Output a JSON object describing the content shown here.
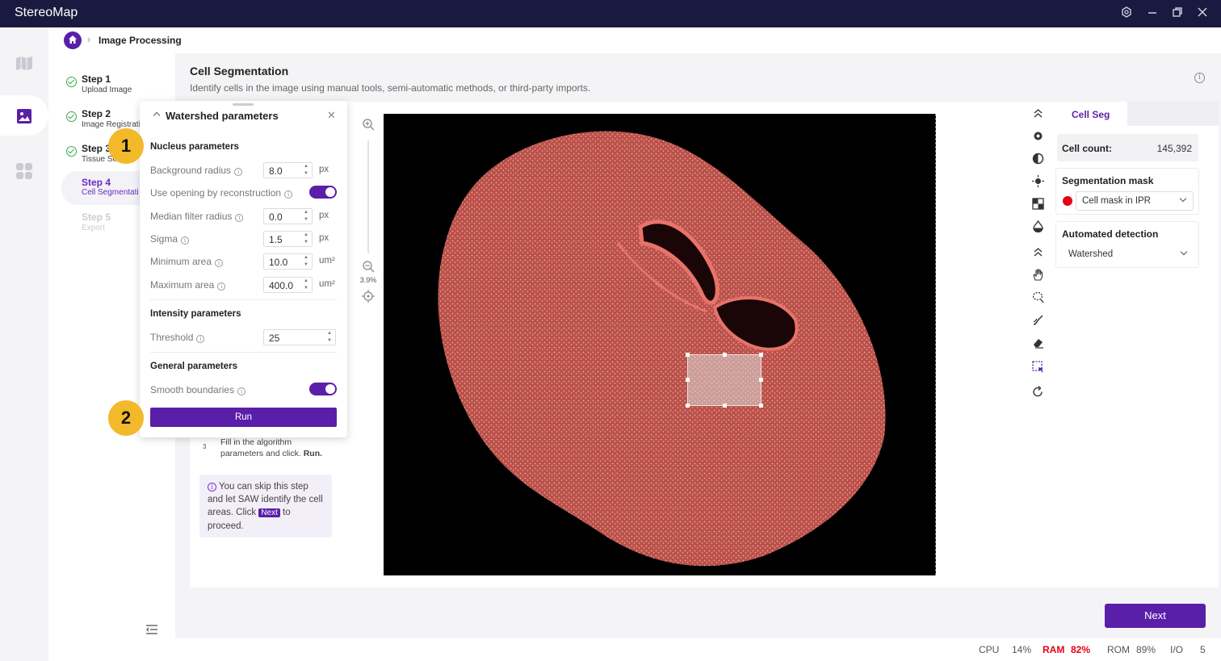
{
  "app": {
    "title": "StereoMap"
  },
  "window_controls": [
    "settings-icon",
    "minimize-icon",
    "restore-icon",
    "close-icon"
  ],
  "breadcrumb": {
    "separator": "›",
    "current": "Image Processing"
  },
  "steps": [
    {
      "title": "Step 1",
      "sub": "Upload Image",
      "state": "done"
    },
    {
      "title": "Step 2",
      "sub": "Image Registrati",
      "state": "done"
    },
    {
      "title": "Step 3",
      "sub": "Tissue Se",
      "state": "done"
    },
    {
      "title": "Step 4",
      "sub": "Cell Segmentati",
      "state": "active"
    },
    {
      "title": "Step 5",
      "sub": "Export",
      "state": "disabled"
    }
  ],
  "page": {
    "title": "Cell Segmentation",
    "description": "Identify cells in the image using manual tools, semi-automatic methods, or third-party imports."
  },
  "guide": {
    "step3_num": "3",
    "step3_text": "Fill in the algorithm parameters and click.",
    "step3_action": "Run.",
    "skip_pre": "You can skip this step and let SAW identify the cell areas. Click",
    "skip_chip": "Next",
    "skip_post": "to proceed."
  },
  "viewer": {
    "zoom_percent": "3.9%"
  },
  "right_panel": {
    "tab": "Cell Seg",
    "cell_count_label": "Cell count:",
    "cell_count_value": "145,392",
    "mask_title": "Segmentation mask",
    "mask_value": "Cell mask in IPR",
    "mask_color": "#e60012",
    "detection_title": "Automated detection",
    "detection_value": "Watershed"
  },
  "next_button": "Next",
  "status": {
    "cpu_label": "CPU",
    "cpu_value": "14%",
    "ram_label": "RAM",
    "ram_value": "82%",
    "rom_label": "ROM",
    "rom_value": "89%",
    "io_label": "I/O",
    "io_value": "5"
  },
  "popover": {
    "title": "Watershed parameters",
    "nucleus_title": "Nucleus parameters",
    "params": {
      "background_radius": {
        "label": "Background radius",
        "value": "8.0",
        "unit": "px"
      },
      "opening": {
        "label": "Use opening by reconstruction",
        "on": true
      },
      "median": {
        "label": "Median filter radius",
        "value": "0.0",
        "unit": "px"
      },
      "sigma": {
        "label": "Sigma",
        "value": "1.5",
        "unit": "px"
      },
      "min_area": {
        "label": "Minimum area",
        "value": "10.0",
        "unit": "um²"
      },
      "max_area": {
        "label": "Maximum area",
        "value": "400.0",
        "unit": "um²"
      }
    },
    "intensity_title": "Intensity parameters",
    "threshold": {
      "label": "Threshold",
      "value": "25"
    },
    "general_title": "General parameters",
    "smooth": {
      "label": "Smooth boundaries",
      "on": true
    },
    "run_label": "Run"
  },
  "callouts": {
    "one": "1",
    "two": "2"
  },
  "colors": {
    "accent": "#5a1fa8",
    "titlebar": "#1a1a40",
    "tissue": "#e8736a",
    "warn": "#e60012"
  }
}
